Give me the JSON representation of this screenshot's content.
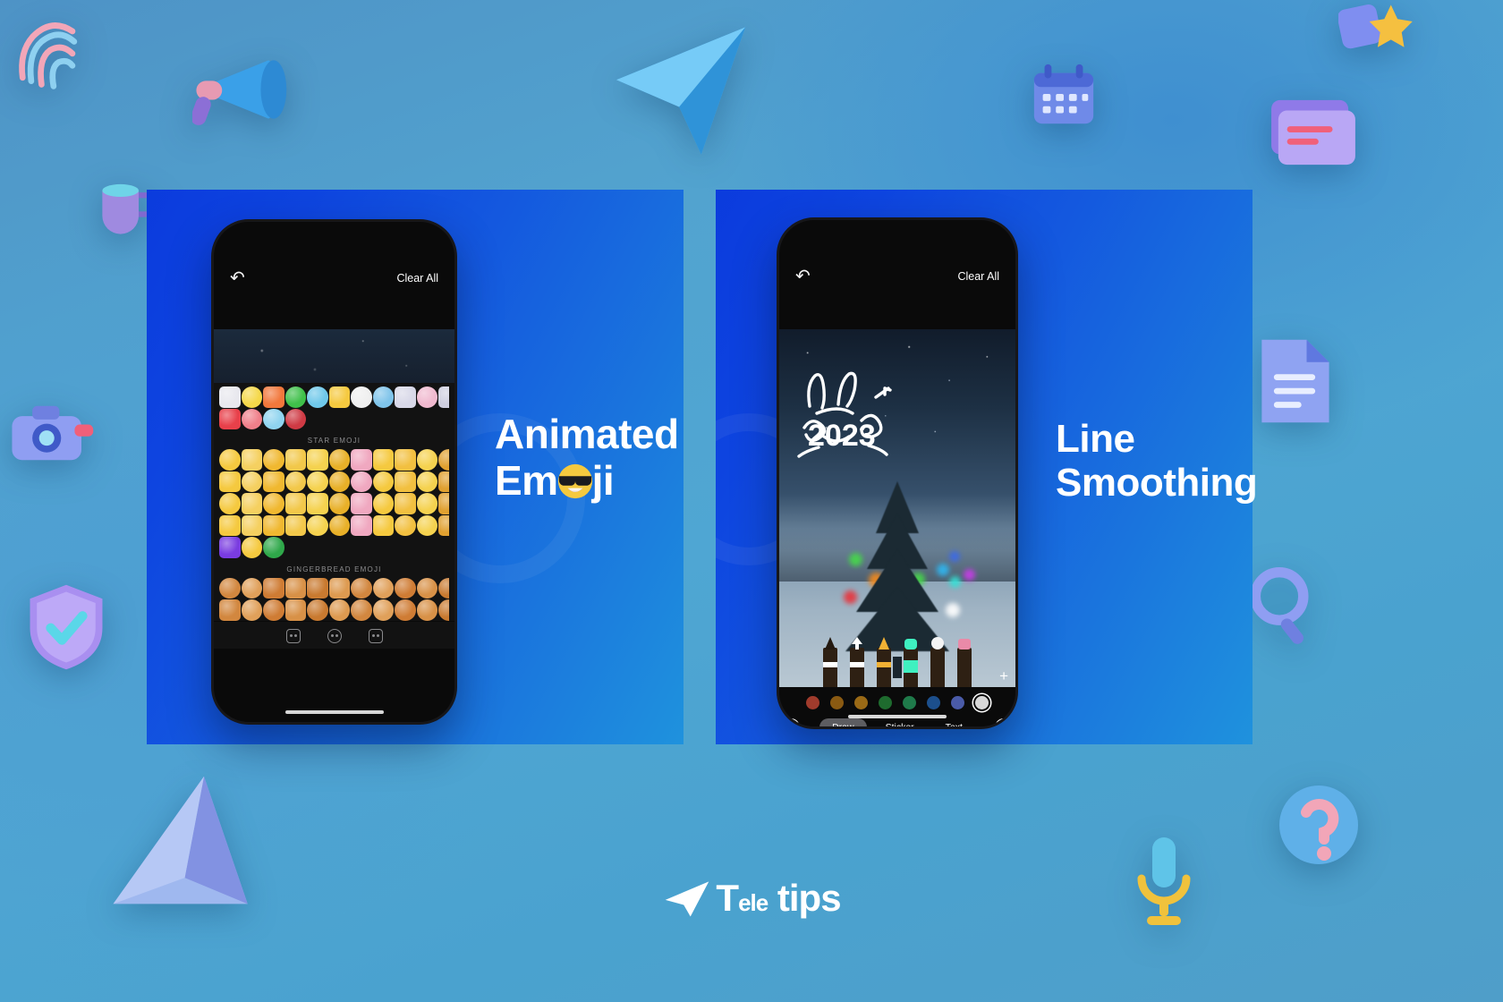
{
  "background": {
    "base_color": "#4fa1cf",
    "decorations": [
      {
        "name": "fingerprint-icon"
      },
      {
        "name": "megaphone-icon"
      },
      {
        "name": "cup-icon"
      },
      {
        "name": "paper-plane-icon"
      },
      {
        "name": "calendar-icon"
      },
      {
        "name": "card-icon"
      },
      {
        "name": "star-icon"
      },
      {
        "name": "camera-icon"
      },
      {
        "name": "document-icon"
      },
      {
        "name": "shield-check-icon"
      },
      {
        "name": "magnifier-icon"
      },
      {
        "name": "triangle-icon"
      },
      {
        "name": "question-mark-icon"
      },
      {
        "name": "microphone-icon"
      }
    ]
  },
  "panels": [
    {
      "id": "animated-emoji",
      "accent": "#0b3bdd",
      "caption_line1": "Animated",
      "caption_line2_before": "Em",
      "caption_line2_after": "ji",
      "caption_emoji": "cool-face-emoji",
      "phone": {
        "topbar": {
          "undo_icon": "undo-arrow-icon",
          "clear_all": "Clear All"
        },
        "sections": [
          {
            "title": "",
            "rows": 2
          },
          {
            "title": "STAR EMOJI",
            "rows": 5
          },
          {
            "title": "GINGERBREAD EMOJI",
            "rows": 2
          }
        ],
        "tabs": [
          {
            "name": "sticker-tab-icon"
          },
          {
            "name": "emoji-tab-icon"
          },
          {
            "name": "mask-tab-icon"
          }
        ]
      }
    },
    {
      "id": "line-smoothing",
      "accent": "#0b3bdd",
      "caption_line1": "Line",
      "caption_line2": "Smoothing",
      "phone": {
        "topbar": {
          "undo_icon": "undo-arrow-icon",
          "clear_all": "Clear All"
        },
        "drawing_text": "2023",
        "brushes": [
          {
            "name": "pen-brush",
            "tip": "#2e2013"
          },
          {
            "name": "arrow-brush",
            "tip": "#ffffff"
          },
          {
            "name": "marker-brush",
            "tip": "#f2b134"
          },
          {
            "name": "neon-brush",
            "tip": "#3ff0c0"
          },
          {
            "name": "eraser-brush",
            "tip": "#f2f2f2"
          },
          {
            "name": "blur-brush",
            "tip": "#e98aa8"
          }
        ],
        "add_button": "+",
        "colors": [
          "#a03b2c",
          "#8a5a12",
          "#9a6a16",
          "#1e6b2e",
          "#1f7a4a",
          "#1c4f8c",
          "#4a5ba8",
          "#d8d8d8"
        ],
        "selected_color_index": 7,
        "modes": [
          {
            "label": "Draw",
            "active": true
          },
          {
            "label": "Sticker",
            "active": false
          },
          {
            "label": "Text",
            "active": false
          }
        ],
        "cancel_icon": "close-circle-icon",
        "confirm_icon": "check-circle-icon"
      }
    }
  ],
  "footer": {
    "logo_mark": "telegram-plane-logo",
    "logo_word_primary": "T",
    "logo_word_small": "ele",
    "logo_word_secondary": "tips"
  }
}
